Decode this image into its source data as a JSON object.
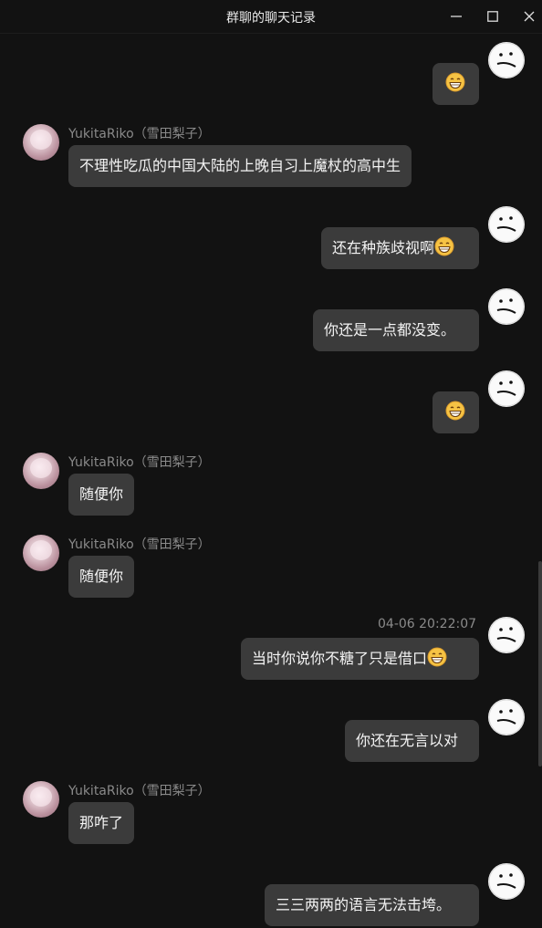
{
  "window": {
    "title": "群聊的聊天记录",
    "minimize_icon": "minimize-icon",
    "maximize_icon": "maximize-icon",
    "close_icon": "close-icon"
  },
  "peer": {
    "name": "YukitaRiko（雪田梨子）"
  },
  "messages": [
    {
      "from": "self",
      "text": "",
      "emoji": "grinning-face"
    },
    {
      "from": "peer",
      "text": "不理性吃瓜的中国大陆的上晚自习上魔杖的高中生"
    },
    {
      "from": "self",
      "text": "还在种族歧视啊",
      "emoji": "grinning-face"
    },
    {
      "from": "self",
      "text": "你还是一点都没变。"
    },
    {
      "from": "self",
      "text": "",
      "emoji": "grinning-face"
    },
    {
      "from": "peer",
      "text": "随便你"
    },
    {
      "from": "peer",
      "text": "随便你"
    },
    {
      "from": "self",
      "timestamp": "04-06 20:22:07",
      "text": "当时你说你不糖了只是借口",
      "emoji": "grinning-face"
    },
    {
      "from": "self",
      "text": "你还在无言以对"
    },
    {
      "from": "peer",
      "text": "那咋了"
    },
    {
      "from": "self",
      "text": "三三两两的语言无法击垮。"
    }
  ]
}
